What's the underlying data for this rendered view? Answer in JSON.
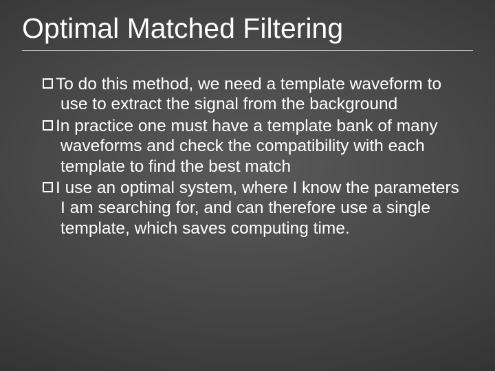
{
  "title": "Optimal Matched Filtering",
  "bullets": [
    "To do this method, we need a template waveform to use to extract the signal from the background",
    "In practice one must have a template bank of many waveforms and check the compatibility with each template to find the best match",
    "I use an optimal system, where I know the parameters I am searching for, and can therefore use a single template, which saves computing time."
  ]
}
